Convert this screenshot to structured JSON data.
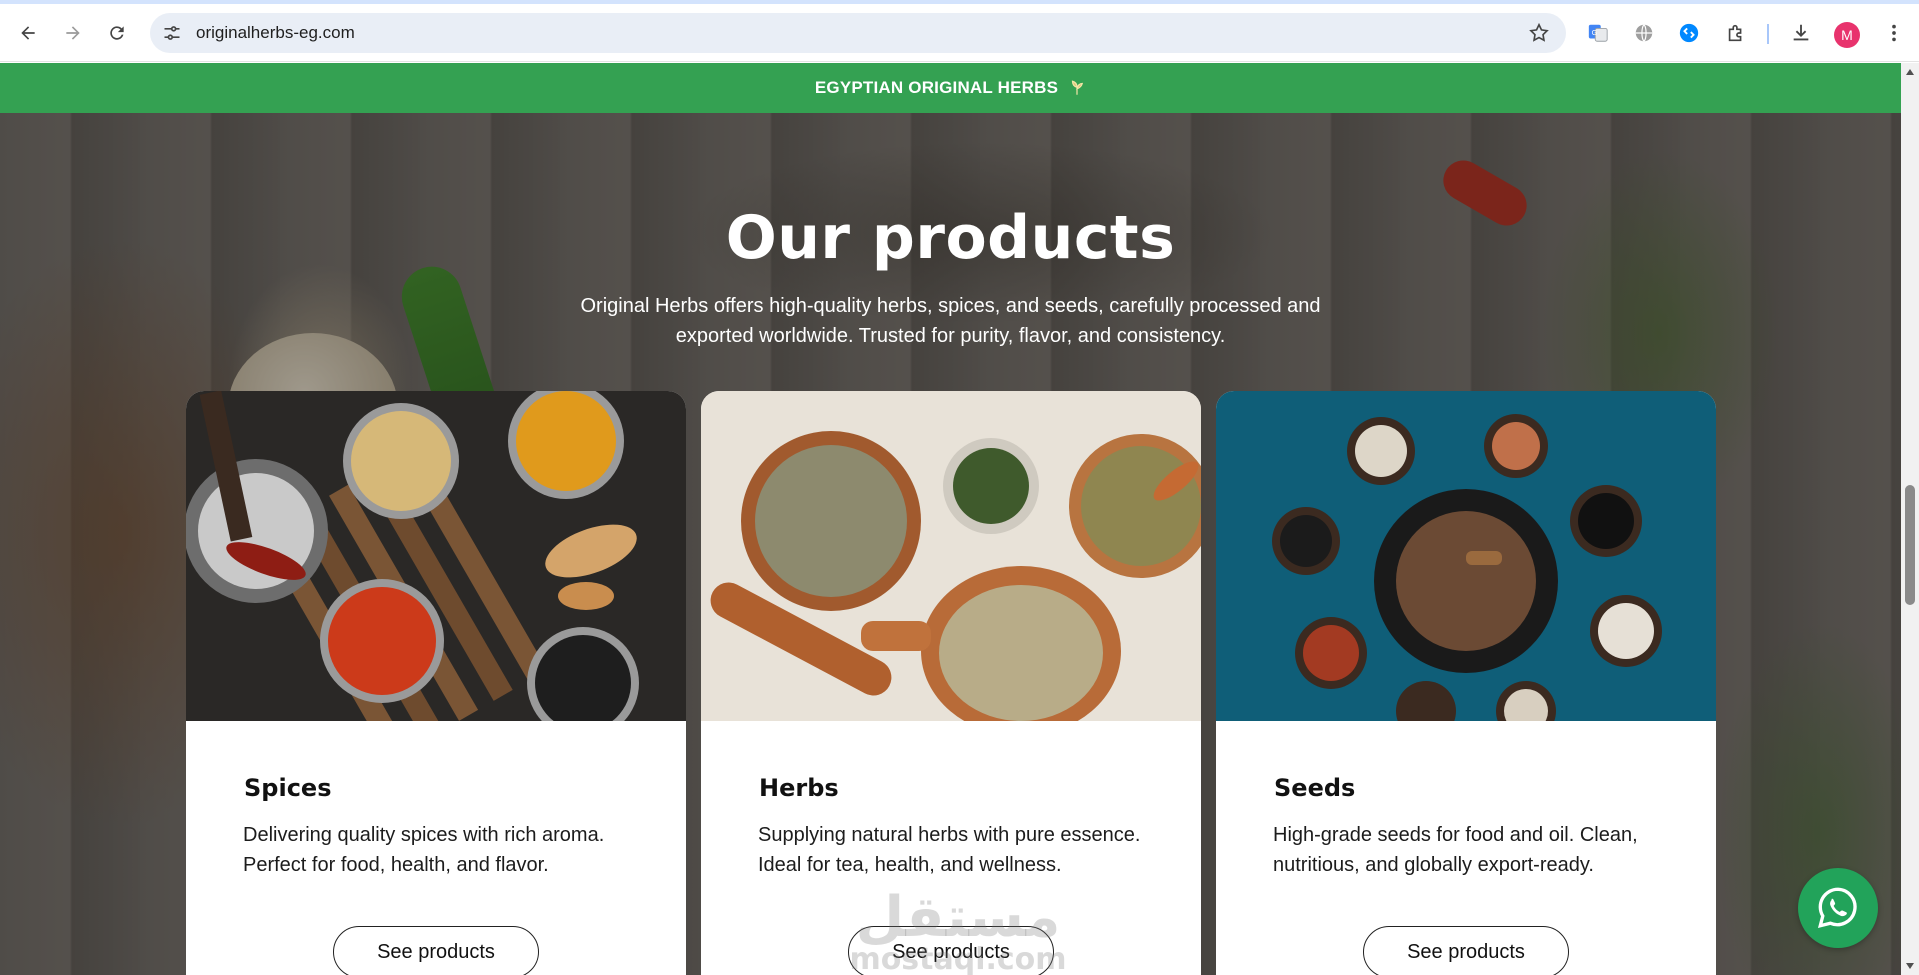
{
  "browser": {
    "url": "originalherbs-eg.com",
    "avatar_initial": "M",
    "icons": {
      "back": "arrow-left-icon",
      "forward": "arrow-right-icon",
      "reload": "reload-icon",
      "site_settings": "tune-icon",
      "bookmark": "star-icon",
      "translate": "google-translate-icon",
      "language": "globe-icon",
      "shazam": "shazam-icon",
      "extensions": "puzzle-icon",
      "downloads": "download-icon",
      "menu": "kebab-menu-icon"
    }
  },
  "announcement": {
    "text": "EGYPTIAN ORIGINAL HERBS",
    "color": "#34a152"
  },
  "hero": {
    "title": "Our products",
    "subtitle": "Original Herbs offers high-quality herbs, spices, and seeds, carefully processed and exported worldwide. Trusted for purity, flavor, and consistency."
  },
  "products": [
    {
      "name": "Spices",
      "description": "Delivering quality spices with rich aroma. Perfect for food, health, and flavor.",
      "button": "See products"
    },
    {
      "name": "Herbs",
      "description": "Supplying natural herbs with pure essence. Ideal for tea, health, and wellness.",
      "button": "See products"
    },
    {
      "name": "Seeds",
      "description": "High-grade seeds for food and oil. Clean, nutritious, and globally export-ready.",
      "button": "See products"
    }
  ],
  "watermark": {
    "arabic": "مستقل",
    "latin": "mostaql.com"
  },
  "whatsapp": {
    "icon": "whatsapp-icon",
    "color": "#22a35a"
  }
}
